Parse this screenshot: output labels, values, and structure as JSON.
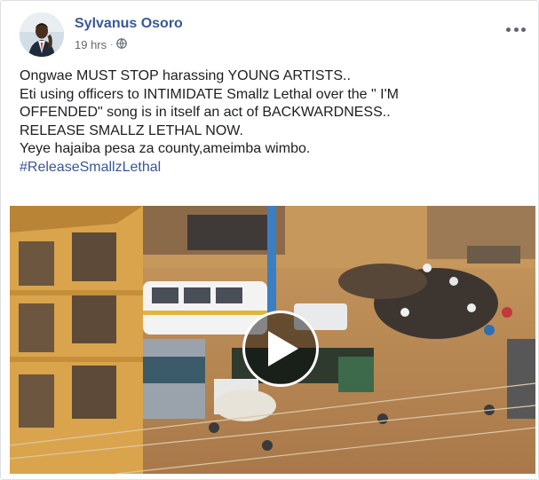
{
  "post": {
    "author": "Sylvanus Osoro",
    "time": "19 hrs",
    "separator": "·",
    "lines": [
      "Ongwae MUST STOP harassing YOUNG ARTISTS..",
      "Eti using officers to INTIMIDATE Smallz Lethal over the \" I'M",
      "OFFENDED\" song is in itself an act of BACKWARDNESS..",
      "RELEASE SMALLZ LETHAL NOW.",
      "Yeye hajaiba pesa za county,ameimba wimbo."
    ],
    "hashtag": "#ReleaseSmallzLethal"
  },
  "icons": {
    "audience": "globe-icon",
    "menu": "more-options-icon",
    "play": "play-icon"
  },
  "colors": {
    "author_link": "#385898",
    "text": "#1c1e21",
    "meta": "#616770"
  }
}
